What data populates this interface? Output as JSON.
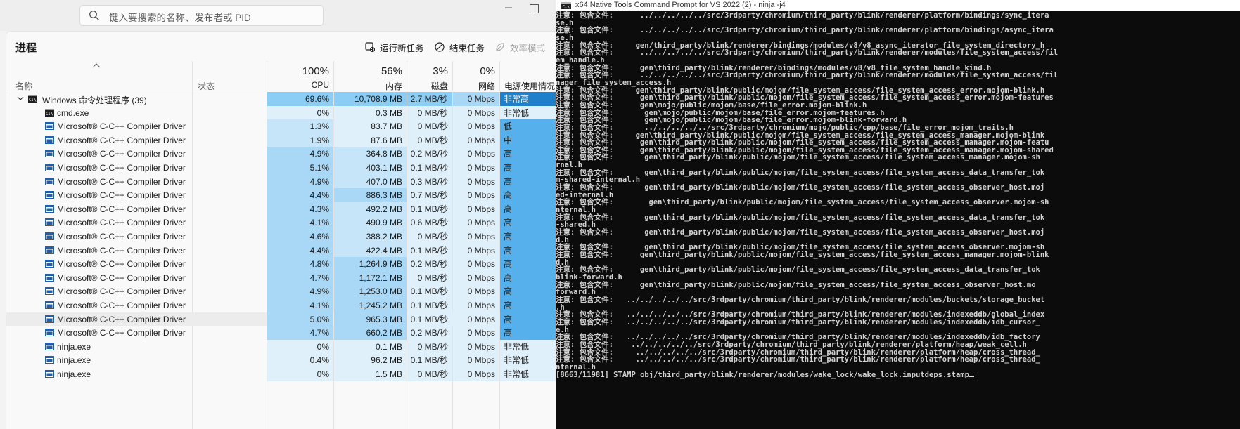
{
  "search": {
    "placeholder": "键入要搜索的名称、发布者或 PID"
  },
  "header": {
    "title": "进程",
    "run_task": "运行新任务",
    "end_task": "结束任务",
    "efficiency": "效率模式"
  },
  "columns": {
    "name": "名称",
    "status": "状态",
    "cpu_pct": "100%",
    "cpu": "CPU",
    "mem_pct": "56%",
    "mem": "内存",
    "disk_pct": "3%",
    "disk": "磁盘",
    "net_pct": "0%",
    "net": "网络",
    "power": "电源使用情况"
  },
  "colors": {
    "heat1": "#dff0fb",
    "heat2": "#c6e5f9",
    "heat3": "#a9d8f7",
    "heat4": "#8ccdf5",
    "term_bg": "#0c0c0c"
  },
  "rows": [
    {
      "name": "Windows 命令处理程序 (39)",
      "type": "group",
      "icon": "cmd-icon",
      "cpu": "69.6%",
      "mem": "10,708.9 MB",
      "disk": "2.7 MB/秒",
      "net": "0 Mbps",
      "power": "非常高",
      "h": [
        4,
        4,
        4,
        3,
        "p"
      ]
    },
    {
      "name": "cmd.exe",
      "type": "child",
      "icon": "cmd-icon",
      "cpu": "0%",
      "mem": "0.3 MB",
      "disk": "0 MB/秒",
      "net": "0 Mbps",
      "power": "非常低",
      "h": [
        1,
        1,
        1,
        1,
        1
      ]
    },
    {
      "name": "Microsoft® C-C++ Compiler Driver",
      "type": "child",
      "icon": "app-icon",
      "cpu": "1.3%",
      "mem": "83.7 MB",
      "disk": "0 MB/秒",
      "net": "0 Mbps",
      "power": "低",
      "h": [
        2,
        1,
        1,
        1,
        "p"
      ]
    },
    {
      "name": "Microsoft® C-C++ Compiler Driver",
      "type": "child",
      "icon": "app-icon",
      "cpu": "1.9%",
      "mem": "87.6 MB",
      "disk": "0 MB/秒",
      "net": "0 Mbps",
      "power": "中",
      "h": [
        2,
        1,
        1,
        1,
        "p"
      ]
    },
    {
      "name": "Microsoft® C-C++ Compiler Driver",
      "type": "child",
      "icon": "app-icon",
      "cpu": "4.9%",
      "mem": "364.8 MB",
      "disk": "0.2 MB/秒",
      "net": "0 Mbps",
      "power": "高",
      "h": [
        3,
        2,
        1,
        1,
        "p"
      ]
    },
    {
      "name": "Microsoft® C-C++ Compiler Driver",
      "type": "child",
      "icon": "app-icon",
      "cpu": "5.1%",
      "mem": "403.1 MB",
      "disk": "0.1 MB/秒",
      "net": "0 Mbps",
      "power": "高",
      "h": [
        3,
        2,
        1,
        1,
        "p"
      ]
    },
    {
      "name": "Microsoft® C-C++ Compiler Driver",
      "type": "child",
      "icon": "app-icon",
      "cpu": "4.9%",
      "mem": "407.0 MB",
      "disk": "0.3 MB/秒",
      "net": "0 Mbps",
      "power": "高",
      "h": [
        3,
        2,
        1,
        1,
        "p"
      ]
    },
    {
      "name": "Microsoft® C-C++ Compiler Driver",
      "type": "child",
      "icon": "app-icon",
      "cpu": "4.4%",
      "mem": "886.3 MB",
      "disk": "0.7 MB/秒",
      "net": "0 Mbps",
      "power": "高",
      "h": [
        3,
        3,
        1,
        1,
        "p"
      ]
    },
    {
      "name": "Microsoft® C-C++ Compiler Driver",
      "type": "child",
      "icon": "app-icon",
      "cpu": "4.3%",
      "mem": "492.2 MB",
      "disk": "0.1 MB/秒",
      "net": "0 Mbps",
      "power": "高",
      "h": [
        3,
        2,
        1,
        1,
        "p"
      ]
    },
    {
      "name": "Microsoft® C-C++ Compiler Driver",
      "type": "child",
      "icon": "app-icon",
      "cpu": "4.1%",
      "mem": "490.9 MB",
      "disk": "0.6 MB/秒",
      "net": "0 Mbps",
      "power": "高",
      "h": [
        3,
        2,
        1,
        1,
        "p"
      ]
    },
    {
      "name": "Microsoft® C-C++ Compiler Driver",
      "type": "child",
      "icon": "app-icon",
      "cpu": "4.6%",
      "mem": "388.2 MB",
      "disk": "0 MB/秒",
      "net": "0 Mbps",
      "power": "高",
      "h": [
        3,
        2,
        1,
        1,
        "p"
      ]
    },
    {
      "name": "Microsoft® C-C++ Compiler Driver",
      "type": "child",
      "icon": "app-icon",
      "cpu": "4.4%",
      "mem": "422.4 MB",
      "disk": "0.1 MB/秒",
      "net": "0 Mbps",
      "power": "高",
      "h": [
        3,
        2,
        1,
        1,
        "p"
      ]
    },
    {
      "name": "Microsoft® C-C++ Compiler Driver",
      "type": "child",
      "icon": "app-icon",
      "cpu": "4.8%",
      "mem": "1,264.9 MB",
      "disk": "0.2 MB/秒",
      "net": "0 Mbps",
      "power": "高",
      "h": [
        3,
        3,
        1,
        1,
        "p"
      ]
    },
    {
      "name": "Microsoft® C-C++ Compiler Driver",
      "type": "child",
      "icon": "app-icon",
      "cpu": "4.7%",
      "mem": "1,172.1 MB",
      "disk": "0 MB/秒",
      "net": "0 Mbps",
      "power": "高",
      "h": [
        3,
        3,
        1,
        1,
        "p"
      ]
    },
    {
      "name": "Microsoft® C-C++ Compiler Driver",
      "type": "child",
      "icon": "app-icon",
      "cpu": "4.9%",
      "mem": "1,253.0 MB",
      "disk": "0.1 MB/秒",
      "net": "0 Mbps",
      "power": "高",
      "h": [
        3,
        3,
        1,
        1,
        "p"
      ]
    },
    {
      "name": "Microsoft® C-C++ Compiler Driver",
      "type": "child",
      "icon": "app-icon",
      "cpu": "4.1%",
      "mem": "1,245.2 MB",
      "disk": "0.1 MB/秒",
      "net": "0 Mbps",
      "power": "高",
      "h": [
        3,
        3,
        1,
        1,
        "p"
      ]
    },
    {
      "name": "Microsoft® C-C++ Compiler Driver",
      "type": "child",
      "icon": "app-icon",
      "cpu": "5.0%",
      "mem": "965.3 MB",
      "disk": "0.1 MB/秒",
      "net": "0 Mbps",
      "power": "高",
      "h": [
        3,
        3,
        1,
        1,
        "p"
      ],
      "selected": true
    },
    {
      "name": "Microsoft® C-C++ Compiler Driver",
      "type": "child",
      "icon": "app-icon",
      "cpu": "4.7%",
      "mem": "660.2 MB",
      "disk": "0.2 MB/秒",
      "net": "0 Mbps",
      "power": "高",
      "h": [
        3,
        3,
        1,
        1,
        "p"
      ]
    },
    {
      "name": "ninja.exe",
      "type": "child",
      "icon": "app-icon",
      "cpu": "0%",
      "mem": "0.1 MB",
      "disk": "0 MB/秒",
      "net": "0 Mbps",
      "power": "非常低",
      "h": [
        1,
        1,
        1,
        1,
        1
      ]
    },
    {
      "name": "ninja.exe",
      "type": "child",
      "icon": "app-icon",
      "cpu": "0.4%",
      "mem": "96.2 MB",
      "disk": "0.1 MB/秒",
      "net": "0 Mbps",
      "power": "非常低",
      "h": [
        1,
        1,
        1,
        1,
        1
      ]
    },
    {
      "name": "ninja.exe",
      "type": "child",
      "icon": "app-icon",
      "cpu": "0%",
      "mem": "1.5 MB",
      "disk": "0 MB/秒",
      "net": "0 Mbps",
      "power": "非常低",
      "h": [
        1,
        1,
        1,
        1,
        1
      ]
    }
  ],
  "terminal": {
    "title": "x64 Native Tools Command Prompt for VS 2022 (2) - ninja  -j4",
    "lines": [
      "注意: 包含文件:      ../../../../../src/3rdparty/chromium/third_party/blink/renderer/platform/bindings/sync_itera",
      "se.h",
      "注意: 包含文件:      ../../../../../src/3rdparty/chromium/third_party/blink/renderer/platform/bindings/async_itera",
      "se.h",
      "注意: 包含文件:     gen/third_party/blink/renderer/bindings/modules/v8/v8_async_iterator_file_system_directory_h",
      "注意: 包含文件:      ../../../../../src/3rdparty/chromium/third_party/blink/renderer/modules/file_system_access/fil",
      "em_handle.h",
      "注意: 包含文件:      gen\\third_party/blink/renderer/bindings/modules/v8/v8_file_system_handle_kind.h",
      "注意: 包含文件:      ../../../../../src/3rdparty/chromium/third_party/blink/renderer/modules/file_system_access/fil",
      "nager_file_system_access.h",
      "注意: 包含文件:     gen\\third_party/blink/public/mojom/file_system_access/file_system_access_error.mojom-blink.h",
      "注意: 包含文件:      gen\\third_party/blink/public/mojom/file_system_access/file_system_access_error.mojom-features",
      "注意: 包含文件:      gen\\mojo/public/mojom/base/file_error.mojom-blink.h",
      "注意: 包含文件:       gen\\mojo/public/mojom/base/file_error.mojom-features.h",
      "注意: 包含文件:       gen\\mojo/public/mojom/base/file_error.mojom-blink-forward.h",
      "注意: 包含文件:       ../../../../../src/3rdparty/chromium/mojo/public/cpp/base/file_error_mojom_traits.h",
      "注意: 包含文件:     gen\\third_party/blink/public/mojom/file_system_access/file_system_access_manager.mojom-blink",
      "注意: 包含文件:      gen\\third_party/blink/public/mojom/file_system_access/file_system_access_manager.mojom-featu",
      "注意: 包含文件:      gen\\third_party/blink/public/mojom/file_system_access/file_system_access_manager.mojom-shared",
      "注意: 包含文件:       gen\\third_party/blink/public/mojom/file_system_access/file_system_access_manager.mojom-sh",
      "rnal.h",
      "注意: 包含文件:       gen\\third_party/blink/public/mojom/file_system_access/file_system_access_data_transfer_tok",
      "m-shared-internal.h",
      "注意: 包含文件:       gen\\third_party/blink/public/mojom/file_system_access/file_system_access_observer_host.moj",
      "ed-internal.h",
      "注意: 包含文件:        gen\\third_party/blink/public/mojom/file_system_access/file_system_access_observer.mojom-sh",
      "nternal.h",
      "注意: 包含文件:       gen\\third_party/blink/public/mojom/file_system_access/file_system_access_data_transfer_tok",
      "-shared.h",
      "注意: 包含文件:       gen\\third_party/blink/public/mojom/file_system_access/file_system_access_observer_host.moj",
      "d.h",
      "注意: 包含文件:       gen\\third_party/blink/public/mojom/file_system_access/file_system_access_observer.mojom-sh",
      "注意: 包含文件:      gen\\third_party/blink/public/mojom/file_system_access/file_system_access_manager.mojom-blink",
      "d.h",
      "注意: 包含文件:      gen\\third_party/blink/public/mojom/file_system_access/file_system_access_data_transfer_tok",
      "blink-forward.h",
      "注意: 包含文件:      gen\\third_party/blink/public/mojom/file_system_access/file_system_access_observer_host.mo",
      "forward.h",
      "注意: 包含文件:   ../../../../../src/3rdparty/chromium/third_party/blink/renderer/modules/buckets/storage_bucket",
      ".h",
      "注意: 包含文件:   ../../../../../src/3rdparty/chromium/third_party/blink/renderer/modules/indexeddb/global_index",
      "注意: 包含文件:   ../../../../../src/3rdparty/chromium/third_party/blink/renderer/modules/indexeddb/idb_cursor_",
      "e.h",
      "注意: 包含文件:   ../../../../../src/3rdparty/chromium/third_party/blink/renderer/modules/indexeddb/idb_factory",
      "注意: 包含文件:    ../../../../../src/3rdparty/chromium/third_party/blink/renderer/platform/heap/weak_cell.h",
      "注意: 包含文件:     ../../../../../src/3rdparty/chromium/third_party/blink/renderer/platform/heap/cross_thread_",
      "注意: 包含文件:     ../../../../../src/3rdparty/chromium/third_party/blink/renderer/platform/heap/cross_thread_",
      "nternal.h",
      "[8663/11981] STAMP obj/third_party/blink/renderer/modules/wake_lock/wake_lock.inputdeps.stamp"
    ]
  }
}
